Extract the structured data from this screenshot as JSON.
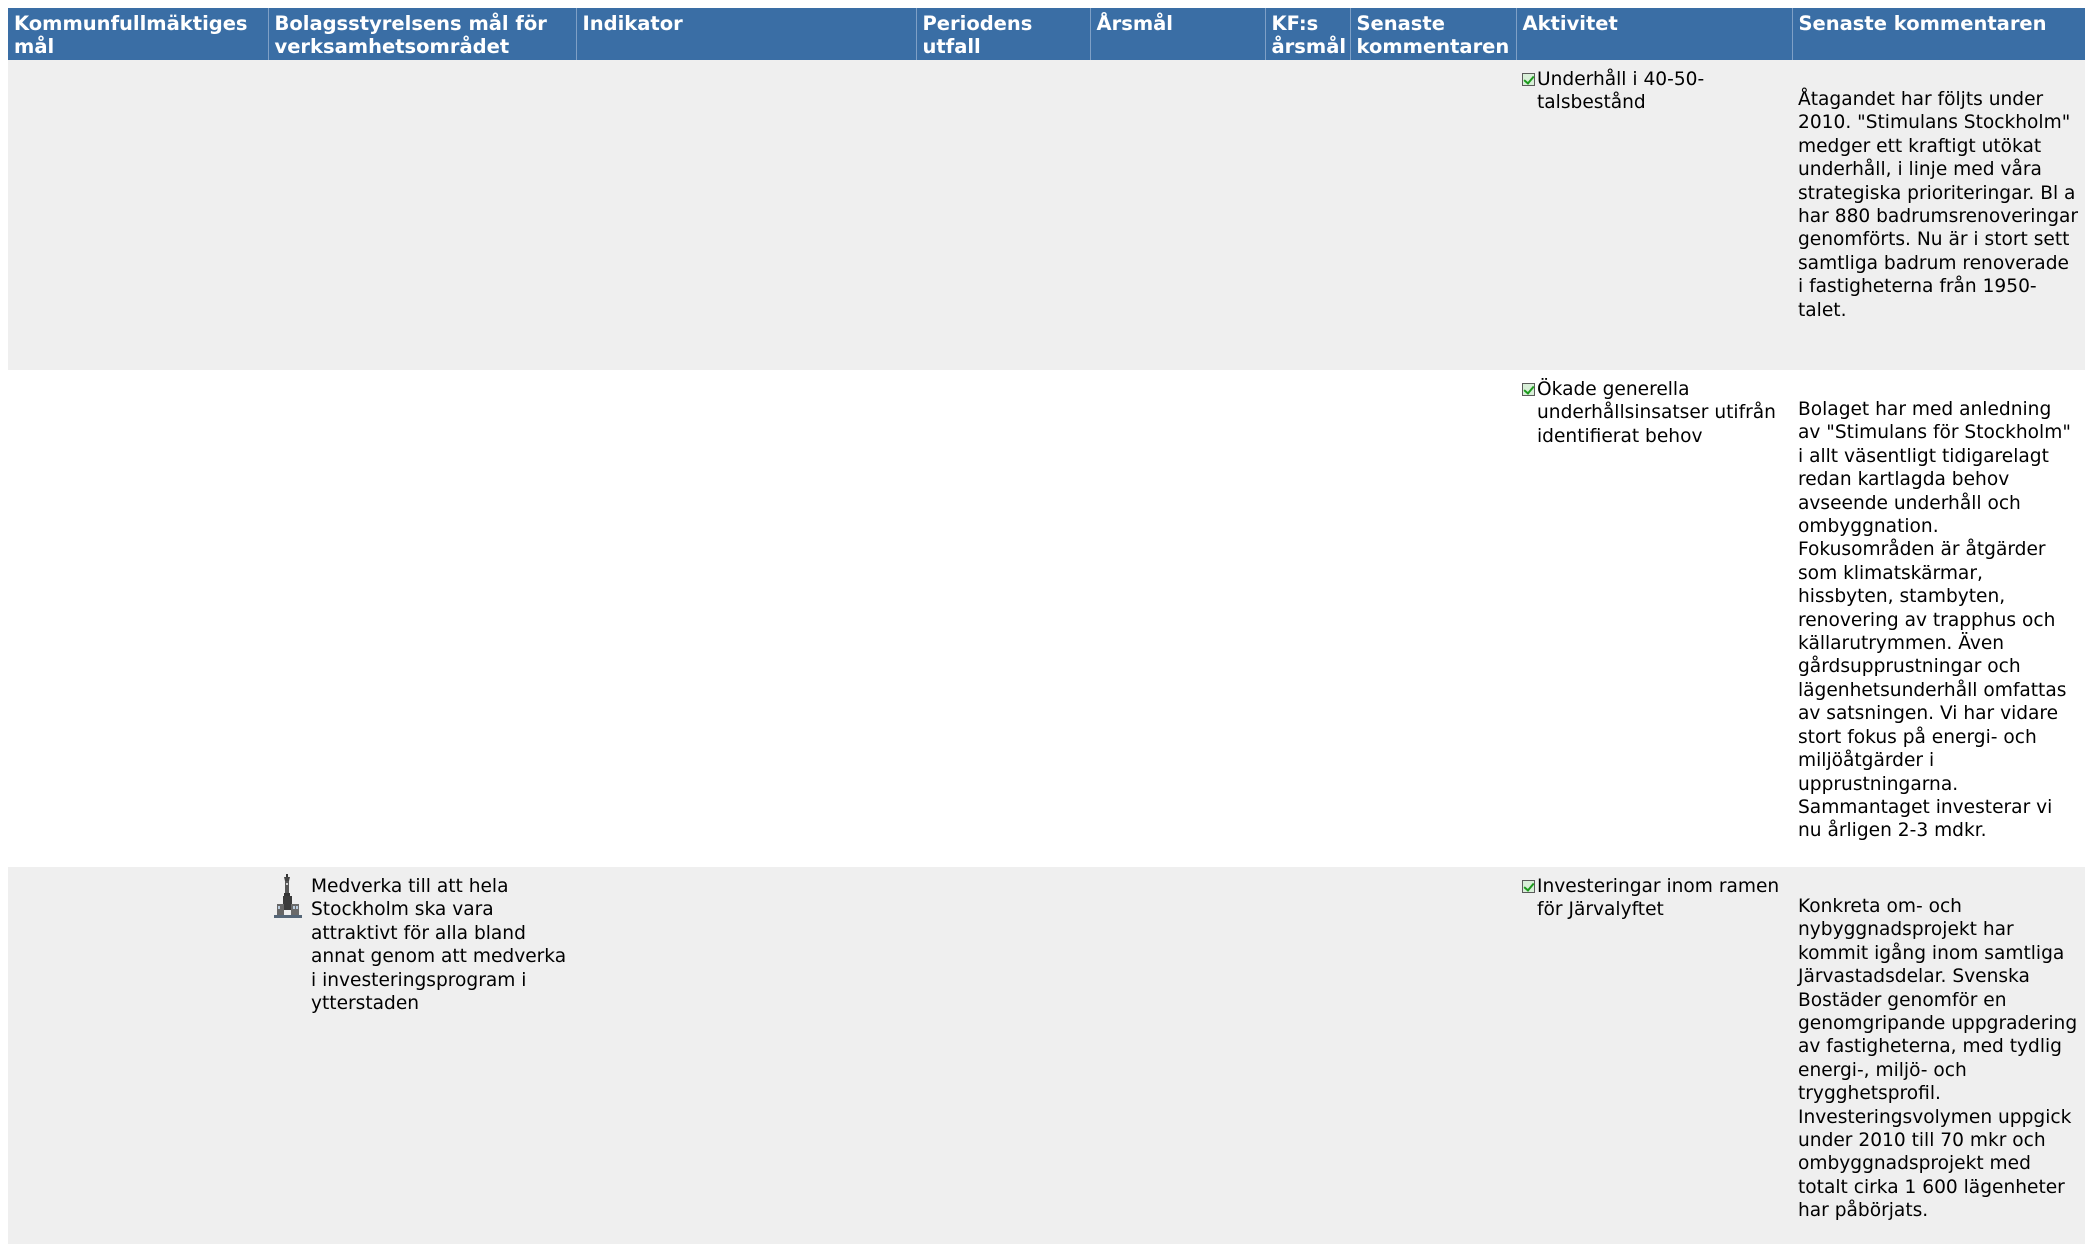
{
  "headers": [
    "Kommunfullmäktiges mål",
    "Bolagsstyrelsens mål för verksamhetsområdet",
    "Indikator",
    "Periodens utfall",
    "Årsmål",
    "KF:s årsmål",
    "Senaste kommentaren",
    "Aktivitet",
    "Senaste kommentaren"
  ],
  "rows": [
    {
      "kf_goal": "",
      "board_goal": "",
      "indicator": "",
      "period_outcome": "",
      "annual_goal": "",
      "kf_annual_goal": "",
      "indicator_comment": "",
      "activity": "Underhåll i 40-50-talsbestånd",
      "activity_status_icon": "checkbox-checked-icon",
      "activity_comment": "Åtagandet har följts under 2010. \"Stimulans Stockholm\" medger ett kraftigt utökat underhåll, i linje med våra strategiska prioriteringar. Bl a har 880 badrumsrenoveringar genomförts. Nu är i stort sett samtliga badrum renoverade i fastigheterna från 1950-talet."
    },
    {
      "kf_goal": "",
      "board_goal": "",
      "indicator": "",
      "period_outcome": "",
      "annual_goal": "",
      "kf_annual_goal": "",
      "indicator_comment": "",
      "activity": "Ökade generella underhållsinsatser utifrån identifierat behov",
      "activity_status_icon": "checkbox-checked-icon",
      "activity_comment": "Bolaget har med anledning av \"Stimulans för Stockholm\" i allt väsentligt tidigarelagt redan kartlagda behov avseende underhåll och ombyggnation. Fokusområden är åtgärder som klimatskärmar, hissbyten, stambyten, renovering av trapphus och källarutrymmen. Även gårdsupprustningar och lägenhetsunderhåll omfattas av satsningen. Vi har vidare stort fokus på energi- och miljöåtgärder i upprustningarna. Sammantaget investerar vi nu årligen 2-3 mdkr."
    },
    {
      "kf_goal": "",
      "board_goal": "Medverka till att hela Stockholm ska vara attraktivt för alla bland annat genom att medverka i investeringsprogram i ytterstaden",
      "board_goal_icon": "stockholm-city-hall-icon",
      "indicator": "",
      "period_outcome": "",
      "annual_goal": "",
      "kf_annual_goal": "",
      "indicator_comment": "",
      "activity": "Investeringar inom ramen för Järvalyftet",
      "activity_status_icon": "checkbox-checked-icon",
      "activity_comment": "Konkreta om- och nybyggnadsprojekt har kommit igång inom samtliga Järvastadsdelar. Svenska Bostäder genomför en genomgripande uppgradering av fastigheterna, med tydlig energi-, miljö- och trygghetsprofil. Investeringsvolymen uppgick under 2010 till 70 mkr och ombyggnadsprojekt med totalt cirka 1 600 lägenheter har påbörjats."
    }
  ],
  "colors": {
    "header_bg": "#3a6ea5",
    "header_text": "#ffffff",
    "row_shaded": "#efefef",
    "row_plain": "#ffffff"
  }
}
